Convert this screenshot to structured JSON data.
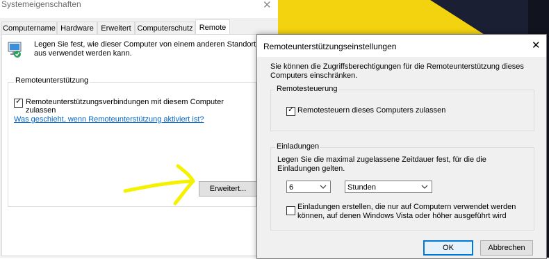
{
  "window": {
    "title": "Systemeigenschaften",
    "close_glyph": "✕",
    "tabs": [
      "Computername",
      "Hardware",
      "Erweitert",
      "Computerschutz",
      "Remote"
    ],
    "active_tab": "Remote",
    "info_text": "Legen Sie fest, wie dieser Computer von einem anderen Standort aus verwendet werden kann.",
    "remote_assistance": {
      "legend": "Remoteunterstützung",
      "checkbox_label": "Remoteunterstützungsverbindungen mit diesem Computer zulassen",
      "checked": true,
      "help_link": "Was geschieht, wenn Remoteunterstützung aktiviert ist?",
      "advanced_button": "Erweitert..."
    }
  },
  "dialog": {
    "title": "Remoteunterstützungseinstellungen",
    "close_glyph": "✕",
    "description": "Sie können die Zugriffsberechtigungen für die Remoteunterstützung dieses Computers einschränken.",
    "remote_control": {
      "legend": "Remotesteuerung",
      "checkbox_label": "Remotesteuern dieses Computers zulassen",
      "checked": true
    },
    "invitations": {
      "legend": "Einladungen",
      "text": "Legen Sie die maximal zugelassene Zeitdauer fest, für die die Einladungen gelten.",
      "duration_value": "6",
      "duration_unit": "Stunden",
      "vista_checkbox_label": "Einladungen erstellen, die nur auf Computern verwendet werden können, auf denen Windows Vista oder höher ausgeführt wird",
      "vista_checked": false
    },
    "ok_button": "OK",
    "cancel_button": "Abbrechen"
  },
  "colors": {
    "link": "#0066cc",
    "highlight": "#f5f200",
    "focus": "#0078d7"
  }
}
